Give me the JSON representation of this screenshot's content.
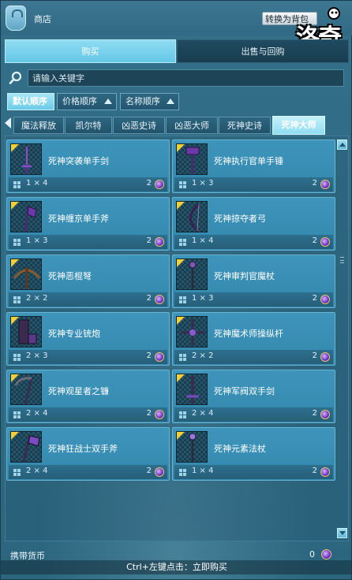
{
  "window": {
    "title": "商店",
    "convert_button": "转换为背包",
    "logo_text": "洛奇"
  },
  "main_tabs": [
    {
      "label": "购买",
      "active": true
    },
    {
      "label": "出售与回购",
      "active": false
    }
  ],
  "search": {
    "placeholder": "请输入关键字"
  },
  "sort_buttons": [
    {
      "label": "默认顺序",
      "active": true
    },
    {
      "label": "价格顺序",
      "active": false
    },
    {
      "label": "名称顺序",
      "active": false
    }
  ],
  "category_tabs": [
    {
      "label": "魔法释放",
      "active": false
    },
    {
      "label": "凯尔特",
      "active": false
    },
    {
      "label": "凶恶史诗",
      "active": false
    },
    {
      "label": "凶恶大师",
      "active": false
    },
    {
      "label": "死神史诗",
      "active": false
    },
    {
      "label": "死神大师",
      "active": true
    }
  ],
  "items": [
    {
      "name": "死神突袭单手剑",
      "size": "1 × 4",
      "price": "2",
      "icon": "sword-icon"
    },
    {
      "name": "死神执行官单手锤",
      "size": "1 × 3",
      "price": "2",
      "icon": "hammer-icon"
    },
    {
      "name": "死神缠京单手斧",
      "size": "1 × 3",
      "price": "2",
      "icon": "axe-icon"
    },
    {
      "name": "死神掠夺者弓",
      "size": "1 × 4",
      "price": "2",
      "icon": "bow-icon"
    },
    {
      "name": "死神恶棍弩",
      "size": "2 × 2",
      "price": "2",
      "icon": "crossbow-icon"
    },
    {
      "name": "死神审判官魔杖",
      "size": "1 × 3",
      "price": "2",
      "icon": "wand-icon"
    },
    {
      "name": "死神专业铳炮",
      "size": "2 × 3",
      "price": "2",
      "icon": "cannon-icon"
    },
    {
      "name": "死神魔术师操纵杆",
      "size": "2 × 2",
      "price": "2",
      "icon": "control-bar-icon"
    },
    {
      "name": "死神观星者之镰",
      "size": "2 × 4",
      "price": "2",
      "icon": "scythe-icon"
    },
    {
      "name": "死神军阀双手剑",
      "size": "2 × 4",
      "price": "2",
      "icon": "greatsword-icon"
    },
    {
      "name": "死神狂战士双手斧",
      "size": "2 × 4",
      "price": "2",
      "icon": "battleaxe-icon"
    },
    {
      "name": "死神元素法杖",
      "size": "1 × 4",
      "price": "2",
      "icon": "staff-icon"
    }
  ],
  "footer": {
    "currency_label": "携带货币",
    "currency_value": "0",
    "hint": "Ctrl+左键点击：立即购买"
  },
  "colors": {
    "background": "#2b657e",
    "active_tab": "#8fdcf3",
    "card": "#3a8fb5",
    "coin": "#6d2fc7",
    "rarity_corner": "#f3cf3a"
  }
}
